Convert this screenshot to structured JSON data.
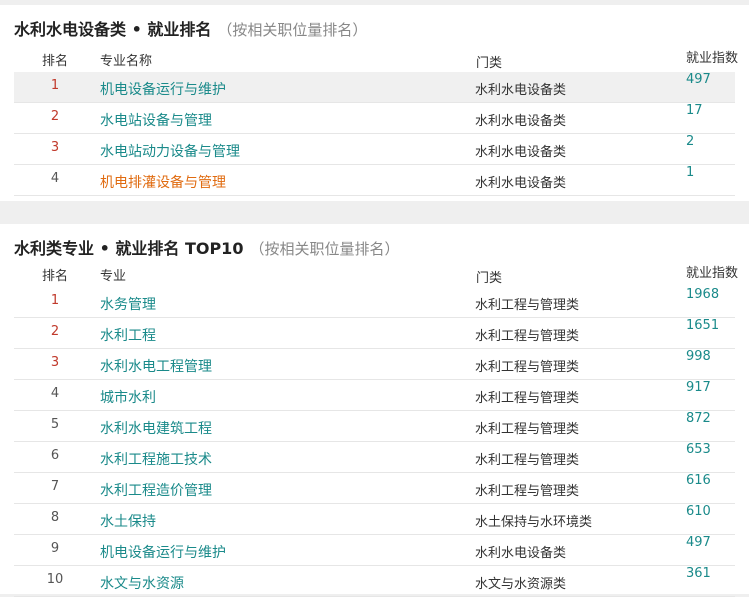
{
  "section1": {
    "title": "水利水电设备类 • 就业排名",
    "subtitle": "（按相关职位量排名）",
    "headers": {
      "rank": "排名",
      "name": "专业名称",
      "category": "门类",
      "index": "就业指数"
    },
    "rows": [
      {
        "rank": "1",
        "name": "机电设备运行与维护",
        "category": "水利水电设备类",
        "index": "497"
      },
      {
        "rank": "2",
        "name": "水电站设备与管理",
        "category": "水利水电设备类",
        "index": "17"
      },
      {
        "rank": "3",
        "name": "水电站动力设备与管理",
        "category": "水利水电设备类",
        "index": "2"
      },
      {
        "rank": "4",
        "name": "机电排灌设备与管理",
        "category": "水利水电设备类",
        "index": "1"
      }
    ]
  },
  "section2": {
    "title": "水利类专业 • 就业排名 TOP10",
    "subtitle": "（按相关职位量排名）",
    "headers": {
      "rank": "排名",
      "name": "专业",
      "category": "门类",
      "index": "就业指数"
    },
    "rows": [
      {
        "rank": "1",
        "name": "水务管理",
        "category": "水利工程与管理类",
        "index": "1968"
      },
      {
        "rank": "2",
        "name": "水利工程",
        "category": "水利工程与管理类",
        "index": "1651"
      },
      {
        "rank": "3",
        "name": "水利水电工程管理",
        "category": "水利工程与管理类",
        "index": "998"
      },
      {
        "rank": "4",
        "name": "城市水利",
        "category": "水利工程与管理类",
        "index": "917"
      },
      {
        "rank": "5",
        "name": "水利水电建筑工程",
        "category": "水利工程与管理类",
        "index": "872"
      },
      {
        "rank": "6",
        "name": "水利工程施工技术",
        "category": "水利工程与管理类",
        "index": "653"
      },
      {
        "rank": "7",
        "name": "水利工程造价管理",
        "category": "水利工程与管理类",
        "index": "616"
      },
      {
        "rank": "8",
        "name": "水土保持",
        "category": "水土保持与水环境类",
        "index": "610"
      },
      {
        "rank": "9",
        "name": "机电设备运行与维护",
        "category": "水利水电设备类",
        "index": "497"
      },
      {
        "rank": "10",
        "name": "水文与水资源",
        "category": "水文与水资源类",
        "index": "361"
      }
    ]
  },
  "colors": {
    "link": "#1a8a8a",
    "top_rank": "#c0392b",
    "highlight_name": "#e06b10"
  }
}
